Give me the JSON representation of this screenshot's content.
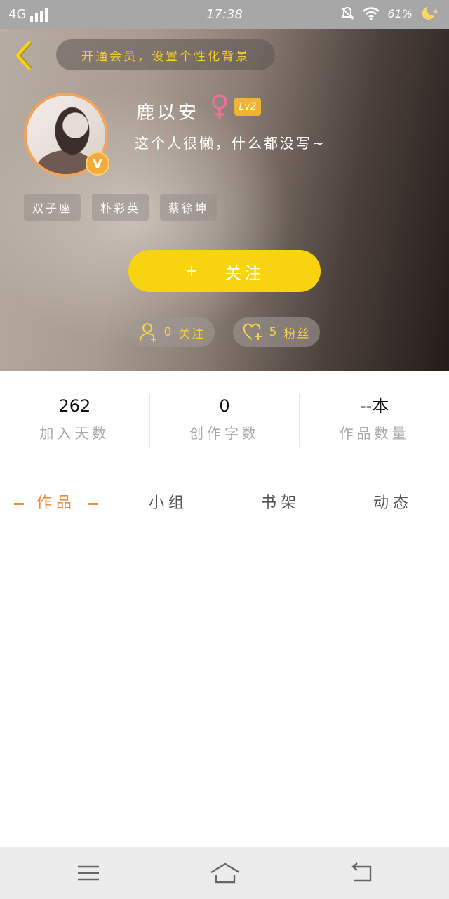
{
  "status_bar": {
    "network": "4G",
    "time": "17:38",
    "battery": "61%"
  },
  "header": {
    "banner_text": "开通会员，设置个性化背景",
    "username": "鹿以安",
    "level": "Lv2",
    "verified_badge": "V",
    "bio": "这个人很懒，什么都没写~",
    "tags": [
      "双子座",
      "朴彩英",
      "蔡徐坤"
    ],
    "follow_plus": "+",
    "follow_label": "关注",
    "following_count": "0",
    "following_label": "关注",
    "fans_count": "5",
    "fans_label": "粉丝"
  },
  "stats": [
    {
      "value": "262",
      "label": "加入天数"
    },
    {
      "value": "0",
      "label": "创作字数"
    },
    {
      "value": "--本",
      "label": "作品数量"
    }
  ],
  "tabs": [
    {
      "label": "作品",
      "active": true
    },
    {
      "label": "小组",
      "active": false
    },
    {
      "label": "书架",
      "active": false
    },
    {
      "label": "动态",
      "active": false
    }
  ],
  "colors": {
    "accent_yellow": "#f7d40f",
    "accent_orange": "#f08a3c",
    "gender_pink": "#e8739a",
    "level_badge": "#f2b233"
  },
  "icons": [
    "back-arrow-icon",
    "female-icon",
    "add-user-icon",
    "heart-plus-icon",
    "menu-icon",
    "home-icon",
    "return-icon"
  ]
}
